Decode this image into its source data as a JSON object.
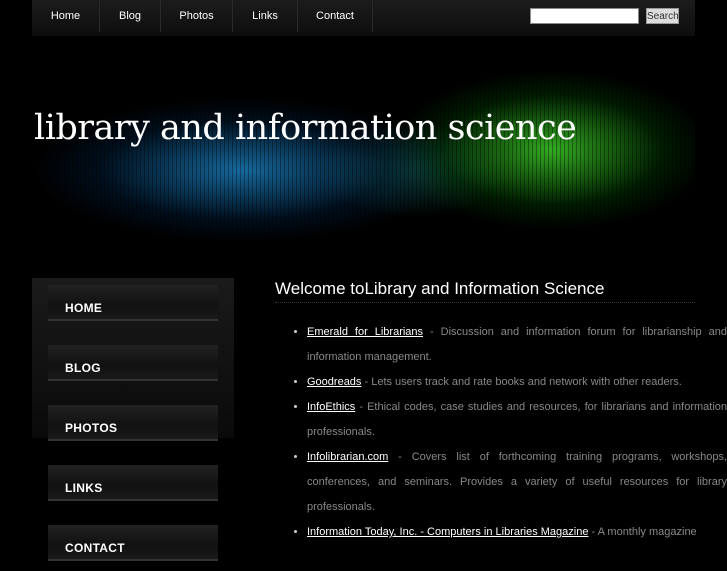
{
  "nav": {
    "items": [
      {
        "label": "Home"
      },
      {
        "label": "Blog"
      },
      {
        "label": "Photos"
      },
      {
        "label": "Links"
      },
      {
        "label": "Contact"
      }
    ],
    "search_value": "",
    "search_button": "Search"
  },
  "header": {
    "site_title": "library and information science"
  },
  "sidebar": {
    "items": [
      {
        "label": "HOME"
      },
      {
        "label": "BLOG"
      },
      {
        "label": "PHOTOS"
      },
      {
        "label": "LINKS"
      },
      {
        "label": "CONTACT"
      }
    ]
  },
  "main": {
    "heading": "Welcome toLibrary and Information Science",
    "links": [
      {
        "title": "Emerald for Librarians",
        "desc": " - Discussion and information forum for librarianship and information management."
      },
      {
        "title": "Goodreads",
        "desc": " - Lets users track and rate books and network with other readers."
      },
      {
        "title": "InfoEthics",
        "desc": " - Ethical codes, case studies and resources, for librarians and information professionals."
      },
      {
        "title": "Infolibrarian.com",
        "desc": " - Covers list of forthcoming training programs, workshops, conferences, and seminars. Provides a variety of useful resources for library professionals."
      },
      {
        "title": "Information Today, Inc. - Computers in Libraries Magazine",
        "desc": " - A monthly magazine"
      }
    ]
  }
}
